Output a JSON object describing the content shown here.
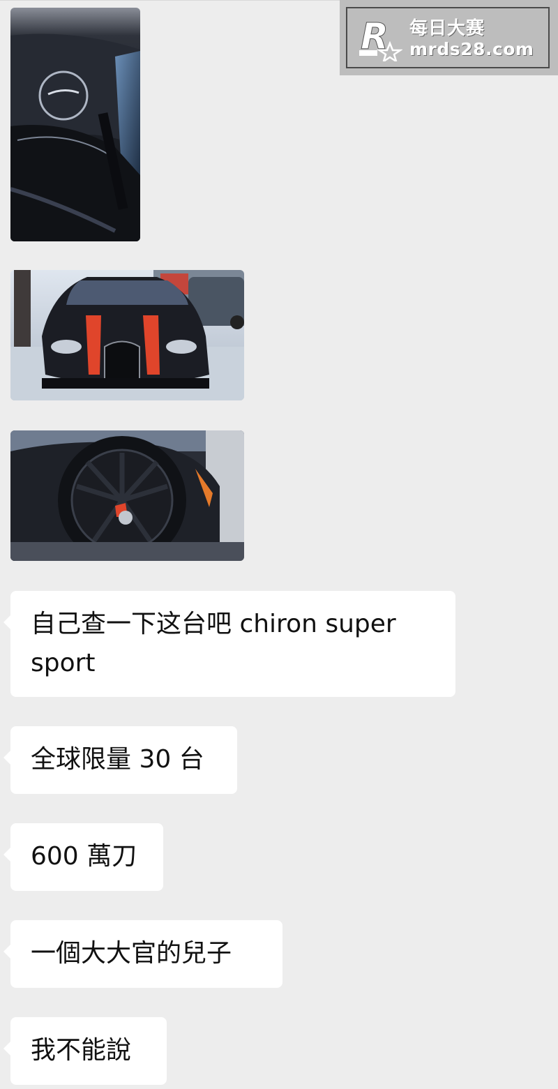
{
  "watermark": {
    "logo_letter": "R",
    "site_name": "每日大赛",
    "site_url": "mrds28.com"
  },
  "photos": [
    {
      "icon": "car-side-window-photo"
    },
    {
      "icon": "car-front-photo"
    },
    {
      "icon": "car-wheel-photo"
    }
  ],
  "messages": [
    {
      "text": "自己查一下这台吧 chiron super sport"
    },
    {
      "text": "全球限量 30 台"
    },
    {
      "text": "600 萬刀"
    },
    {
      "text": "一個大大官的兒子"
    },
    {
      "text": "我不能說"
    }
  ],
  "colors": {
    "background": "#ededed",
    "bubble": "#ffffff",
    "text": "#111111",
    "watermark_bg": "#bdbdbd",
    "car_stripe": "#e0452b"
  }
}
